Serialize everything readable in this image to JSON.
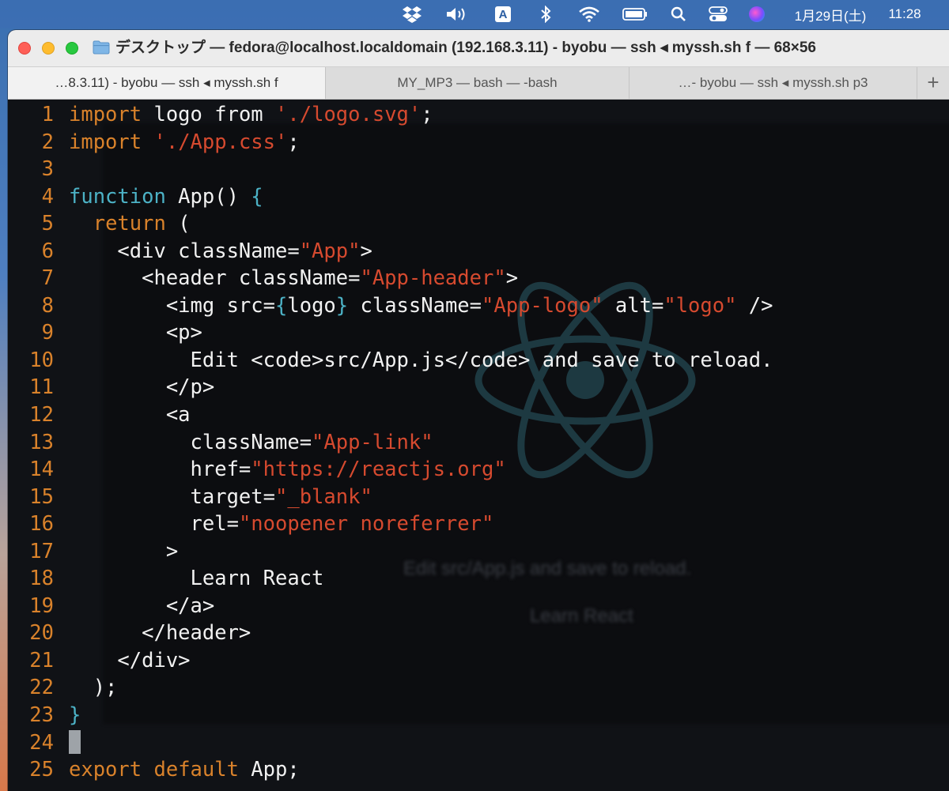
{
  "menubar": {
    "date": "1月29日(土)",
    "time": "11:28",
    "ime": "A",
    "icons": [
      "dropbox-icon",
      "volume-icon",
      "input-method-icon",
      "bluetooth-icon",
      "wifi-icon",
      "battery-icon",
      "search-icon",
      "control-center-icon",
      "siri-icon"
    ]
  },
  "window": {
    "title": "デスクトップ — fedora@localhost.localdomain (192.168.3.11) - byobu — ssh ◂ myssh.sh f — 68×56",
    "tabs": [
      {
        "label": "…8.3.11) - byobu — ssh ◂ myssh.sh f",
        "active": true
      },
      {
        "label": "MY_MP3 — bash — -bash",
        "active": false
      },
      {
        "label": "…- byobu — ssh ◂ myssh.sh p3",
        "active": false
      }
    ],
    "new_tab_label": "+"
  },
  "background": {
    "ghost_line_1": "Edit src/App.js and save to reload.",
    "ghost_line_2": "Learn React"
  },
  "colors": {
    "keyword": "#d9822b",
    "function": "#4cb2c6",
    "string": "#d64a2f",
    "text": "#f1f1f1",
    "line_number": "#d9822b"
  },
  "editor": {
    "lines": [
      {
        "n": "1",
        "tokens": [
          {
            "t": "import",
            "c": "kw"
          },
          {
            "t": " logo ",
            "c": ""
          },
          {
            "t": "from",
            "c": ""
          },
          {
            "t": " ",
            "c": ""
          },
          {
            "t": "'./logo.svg'",
            "c": "str"
          },
          {
            "t": ";",
            "c": ""
          }
        ]
      },
      {
        "n": "2",
        "tokens": [
          {
            "t": "import",
            "c": "kw"
          },
          {
            "t": " ",
            "c": ""
          },
          {
            "t": "'./App.css'",
            "c": "str"
          },
          {
            "t": ";",
            "c": ""
          }
        ]
      },
      {
        "n": "3",
        "tokens": []
      },
      {
        "n": "4",
        "tokens": [
          {
            "t": "function",
            "c": "fn"
          },
          {
            "t": " App() ",
            "c": ""
          },
          {
            "t": "{",
            "c": "br"
          }
        ]
      },
      {
        "n": "5",
        "tokens": [
          {
            "t": "  ",
            "c": ""
          },
          {
            "t": "return",
            "c": "kw"
          },
          {
            "t": " (",
            "c": ""
          }
        ]
      },
      {
        "n": "6",
        "tokens": [
          {
            "t": "    <div className=",
            "c": ""
          },
          {
            "t": "\"App\"",
            "c": "str"
          },
          {
            "t": ">",
            "c": ""
          }
        ]
      },
      {
        "n": "7",
        "tokens": [
          {
            "t": "      <header className=",
            "c": ""
          },
          {
            "t": "\"App-header\"",
            "c": "str"
          },
          {
            "t": ">",
            "c": ""
          }
        ]
      },
      {
        "n": "8",
        "tokens": [
          {
            "t": "        <img src=",
            "c": ""
          },
          {
            "t": "{",
            "c": "br"
          },
          {
            "t": "logo",
            "c": ""
          },
          {
            "t": "}",
            "c": "br"
          },
          {
            "t": " className=",
            "c": ""
          },
          {
            "t": "\"App-logo\"",
            "c": "str"
          },
          {
            "t": " alt=",
            "c": ""
          },
          {
            "t": "\"logo\"",
            "c": "str"
          },
          {
            "t": " />",
            "c": ""
          }
        ]
      },
      {
        "n": "9",
        "tokens": [
          {
            "t": "        <p>",
            "c": ""
          }
        ]
      },
      {
        "n": "10",
        "tokens": [
          {
            "t": "          Edit <code>src/App.js</code> and save to reload.",
            "c": ""
          }
        ]
      },
      {
        "n": "11",
        "tokens": [
          {
            "t": "        </p>",
            "c": ""
          }
        ]
      },
      {
        "n": "12",
        "tokens": [
          {
            "t": "        <a",
            "c": ""
          }
        ]
      },
      {
        "n": "13",
        "tokens": [
          {
            "t": "          className=",
            "c": ""
          },
          {
            "t": "\"App-link\"",
            "c": "str"
          }
        ]
      },
      {
        "n": "14",
        "tokens": [
          {
            "t": "          href=",
            "c": ""
          },
          {
            "t": "\"https://reactjs.org\"",
            "c": "str"
          }
        ]
      },
      {
        "n": "15",
        "tokens": [
          {
            "t": "          target=",
            "c": ""
          },
          {
            "t": "\"_blank\"",
            "c": "str"
          }
        ]
      },
      {
        "n": "16",
        "tokens": [
          {
            "t": "          rel=",
            "c": ""
          },
          {
            "t": "\"noopener noreferrer\"",
            "c": "str"
          }
        ]
      },
      {
        "n": "17",
        "tokens": [
          {
            "t": "        >",
            "c": ""
          }
        ]
      },
      {
        "n": "18",
        "tokens": [
          {
            "t": "          Learn React",
            "c": ""
          }
        ]
      },
      {
        "n": "19",
        "tokens": [
          {
            "t": "        </a>",
            "c": ""
          }
        ]
      },
      {
        "n": "20",
        "tokens": [
          {
            "t": "      </header>",
            "c": ""
          }
        ]
      },
      {
        "n": "21",
        "tokens": [
          {
            "t": "    </div>",
            "c": ""
          }
        ]
      },
      {
        "n": "22",
        "tokens": [
          {
            "t": "  );",
            "c": ""
          }
        ]
      },
      {
        "n": "23",
        "tokens": [
          {
            "t": "}",
            "c": "br"
          }
        ]
      },
      {
        "n": "24",
        "tokens": [],
        "cursor": true
      },
      {
        "n": "25",
        "tokens": [
          {
            "t": "export",
            "c": "kw"
          },
          {
            "t": " ",
            "c": ""
          },
          {
            "t": "default",
            "c": "kw"
          },
          {
            "t": " App;",
            "c": ""
          }
        ]
      }
    ]
  }
}
